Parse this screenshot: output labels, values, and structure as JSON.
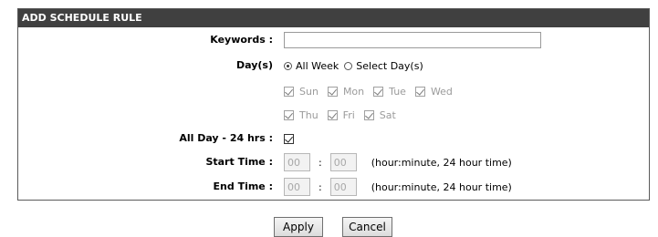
{
  "panel": {
    "title": "ADD SCHEDULE RULE"
  },
  "form": {
    "keywords": {
      "label": "Keywords :",
      "value": ""
    },
    "days": {
      "label": "Day(s)",
      "options": [
        {
          "label": "All Week",
          "checked": true
        },
        {
          "label": "Select Day(s)",
          "checked": false
        }
      ],
      "weekdays_row1": [
        {
          "label": "Sun",
          "checked": true
        },
        {
          "label": "Mon",
          "checked": true
        },
        {
          "label": "Tue",
          "checked": true
        },
        {
          "label": "Wed",
          "checked": true
        }
      ],
      "weekdays_row2": [
        {
          "label": "Thu",
          "checked": true
        },
        {
          "label": "Fri",
          "checked": true
        },
        {
          "label": "Sat",
          "checked": true
        }
      ]
    },
    "all_day": {
      "label": "All Day - 24 hrs :",
      "checked": true
    },
    "start_time": {
      "label": "Start Time :",
      "hour": "00",
      "minute": "00",
      "colon": ":",
      "hint": "(hour:minute, 24 hour time)"
    },
    "end_time": {
      "label": "End Time :",
      "hour": "00",
      "minute": "00",
      "colon": ":",
      "hint": "(hour:minute, 24 hour time)"
    }
  },
  "buttons": {
    "apply": "Apply",
    "cancel": "Cancel"
  }
}
